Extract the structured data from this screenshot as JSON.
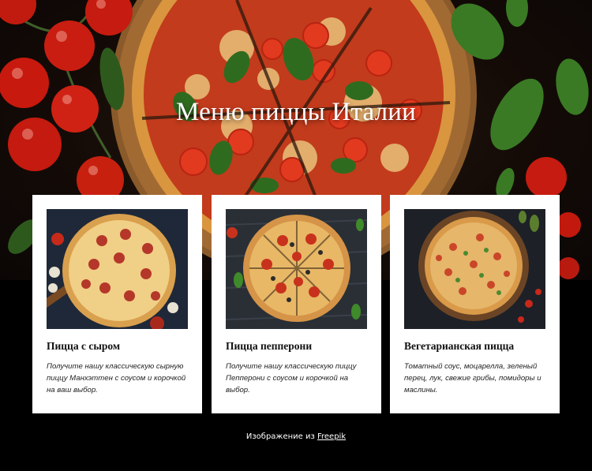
{
  "hero": {
    "title": "Меню пиццы Италии"
  },
  "cards": [
    {
      "name": "Пицца с сыром",
      "description": "Получите нашу классическую сырную пиццу Манхэттен с соусом и корочкой на ваш выбор.",
      "image_icon": "cheese-pizza-photo"
    },
    {
      "name": "Пицца пепперони",
      "description": "Получите нашу классическую пиццу Пепперони с соусом и корочкой на выбор.",
      "image_icon": "pepperoni-pizza-photo"
    },
    {
      "name": "Вегетарианская пицца",
      "description": "Томатный соус, моцарелла, зеленый перец, лук, свежие грибы, помидоры и маслины.",
      "image_icon": "vegetarian-pizza-photo"
    }
  ],
  "credit": {
    "prefix": "Изображение из",
    "link": "Freepik"
  },
  "colors": {
    "background": "#000000",
    "card": "#ffffff",
    "crust": "#d99a4a",
    "tomato": "#c8241a",
    "basil": "#2f6b1f"
  }
}
